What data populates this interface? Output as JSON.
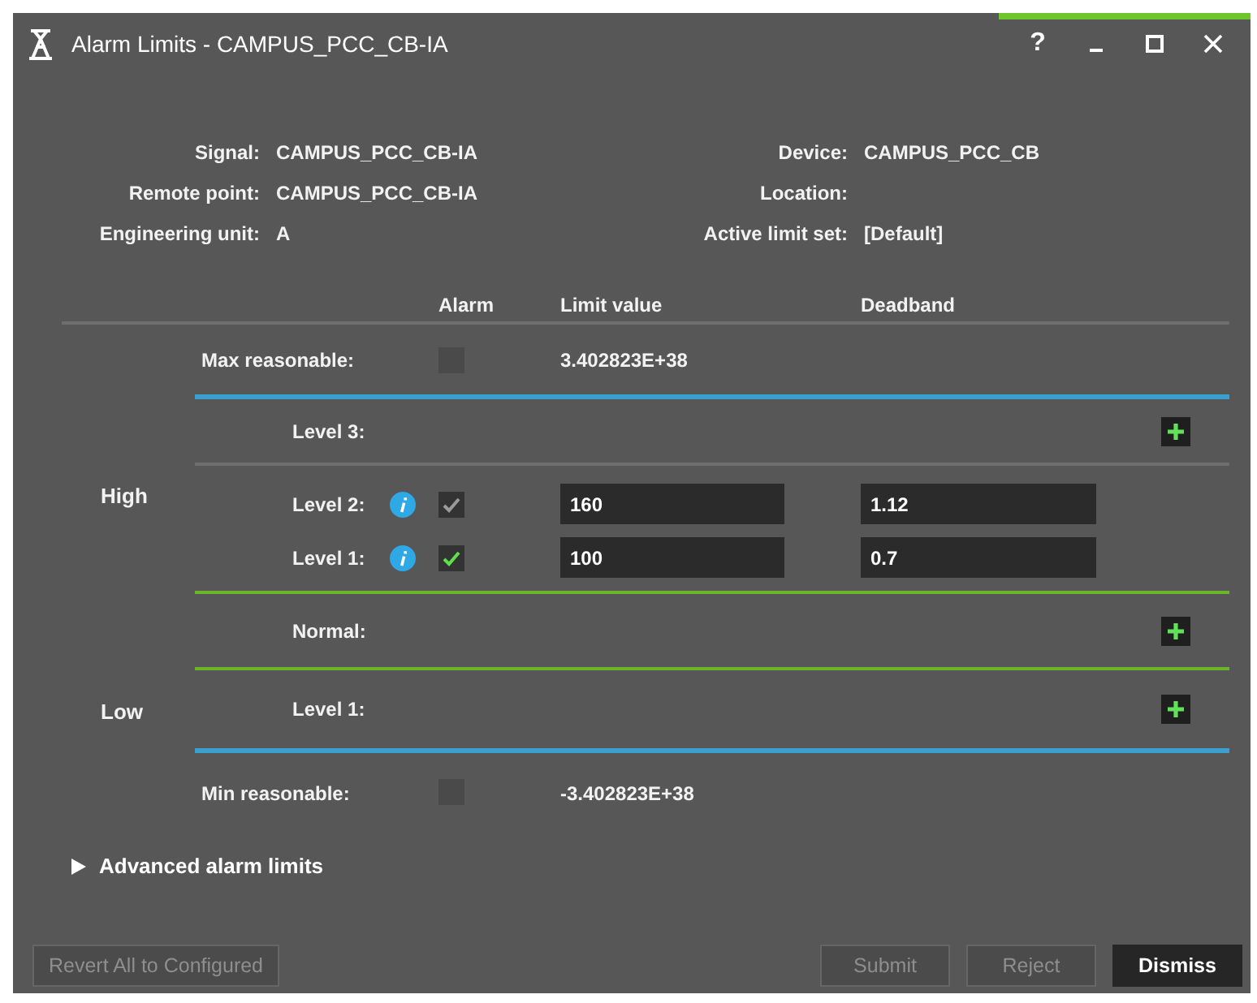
{
  "window": {
    "title": "Alarm Limits - CAMPUS_PCC_CB-IA",
    "help": "?"
  },
  "info_left": [
    {
      "label": "Signal:",
      "value": "CAMPUS_PCC_CB-IA"
    },
    {
      "label": "Remote point:",
      "value": "CAMPUS_PCC_CB-IA"
    },
    {
      "label": "Engineering unit:",
      "value": "A"
    }
  ],
  "info_right": [
    {
      "label": "Device:",
      "value": "CAMPUS_PCC_CB"
    },
    {
      "label": "Location:"
    },
    {
      "label": "Active limit set:",
      "value": "[Default]"
    }
  ],
  "columns": [
    "Alarm",
    "Limit value",
    "Deadband"
  ],
  "sections": [
    {
      "kind": "max",
      "label": "Max reasonable:",
      "checked": false,
      "value": "3.402823E+38"
    },
    {
      "kind": "high",
      "label": "High",
      "levels": [
        {
          "kind": "add",
          "label": "Level 3:"
        },
        {
          "kind": "limit",
          "label": "Level 2:",
          "checked": true,
          "disabled": true,
          "limit": "160",
          "deadband": "1.12"
        },
        {
          "kind": "limit",
          "label": "Level 1:",
          "checked": true,
          "disabled": false,
          "limit": "100",
          "deadband": "0.7"
        }
      ]
    },
    {
      "kind": "normal",
      "levels": [
        {
          "kind": "add",
          "label": "Normal:"
        }
      ]
    },
    {
      "kind": "low",
      "label": "Low",
      "levels": [
        {
          "kind": "add",
          "label": "Level 1:"
        }
      ]
    },
    {
      "kind": "min",
      "label": "Min reasonable:",
      "checked": false,
      "value": "-3.402823E+38"
    }
  ],
  "advanced": {
    "label": "Advanced alarm limits",
    "expanded": false
  },
  "footer_left": [
    {
      "label": "Revert All to Configured",
      "disabled": true
    }
  ],
  "footer_right": [
    {
      "label": "Submit",
      "disabled": true
    },
    {
      "label": "Reject",
      "disabled": true
    },
    {
      "label": "Dismiss",
      "disabled": false
    }
  ]
}
